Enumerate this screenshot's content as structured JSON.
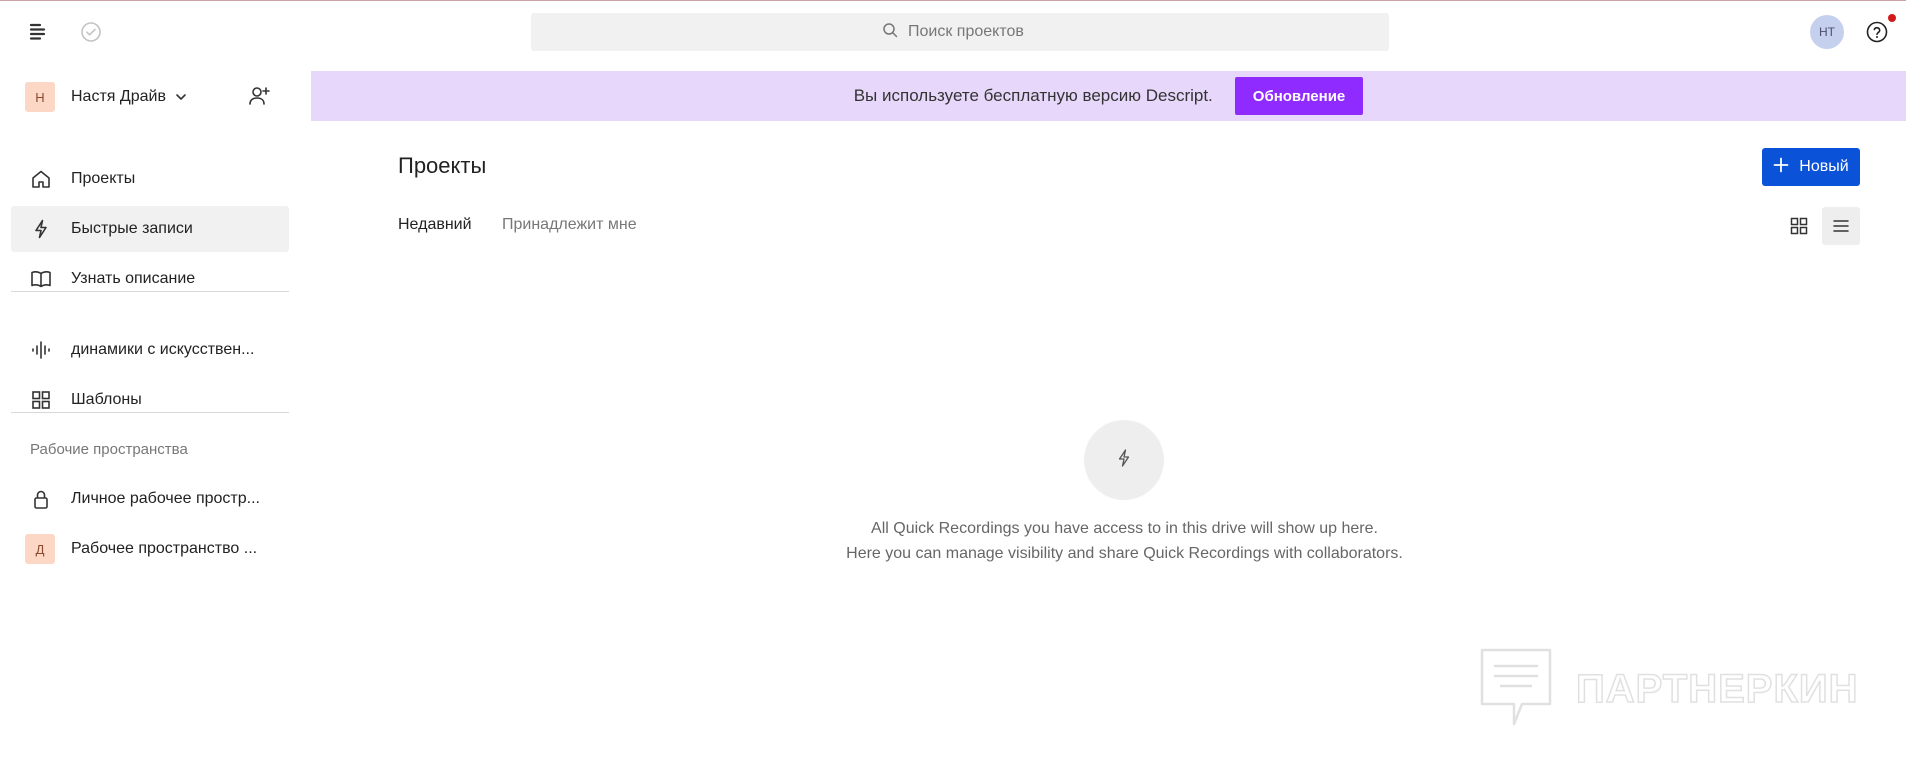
{
  "header": {
    "search_placeholder": "Поиск проектов",
    "avatar_initials": "НТ"
  },
  "sidebar": {
    "workspace_initial": "Н",
    "workspace_name": "Настя Драйв",
    "nav": [
      {
        "label": "Проекты",
        "icon": "home-icon"
      },
      {
        "label": "Быстрые записи",
        "icon": "lightning-icon",
        "active": true
      },
      {
        "label": "Узнать описание",
        "icon": "book-icon"
      }
    ],
    "extras": [
      {
        "label": "динамики с искусствен...",
        "icon": "waveform-icon"
      },
      {
        "label": "Шаблоны",
        "icon": "grid-icon"
      }
    ],
    "workspaces_title": "Рабочие пространства",
    "workspaces": [
      {
        "label": "Личное рабочее простр...",
        "icon": "lock-icon"
      },
      {
        "label": "Рабочее пространство ...",
        "badge": "Д"
      }
    ]
  },
  "banner": {
    "text": "Вы используете бесплатную версию Descript.",
    "button": "Обновление"
  },
  "main": {
    "title": "Проекты",
    "new_button": "Новый",
    "tabs": [
      "Недавний",
      "Принадлежит мне"
    ],
    "empty_line1": "All Quick Recordings you have access to in this drive will show up here.",
    "empty_line2": "Here you can manage visibility and share Quick Recordings with collaborators."
  },
  "watermark": {
    "text": "ПАРТНЕРКИН"
  },
  "colors": {
    "banner_bg": "#e7d8fb",
    "upgrade_button": "#8f2bff",
    "new_button": "#0a52d8",
    "badge_bg": "#fcd7c6",
    "notification_dot": "#d21a1a"
  }
}
